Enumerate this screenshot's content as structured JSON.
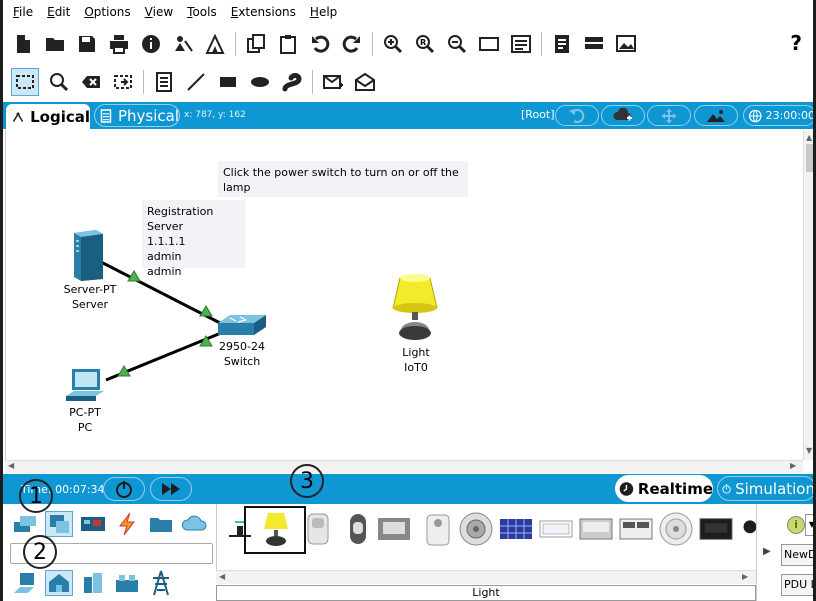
{
  "menu": [
    "File",
    "Edit",
    "Options",
    "View",
    "Tools",
    "Extensions",
    "Help"
  ],
  "menu_underline": [
    "F",
    "E",
    "O",
    "V",
    "T",
    "E",
    "H"
  ],
  "toolbar": {
    "main_icons": [
      "new-file-icon",
      "open-folder-icon",
      "save-icon",
      "print-icon",
      "info-icon",
      "network-wizard-icon",
      "activity-wizard-icon",
      "copy-icon",
      "paste-icon",
      "undo-icon",
      "redo-icon",
      "zoom-in-icon",
      "zoom-reset-icon",
      "zoom-out-icon",
      "drawing-palette-icon",
      "custom-device-icon",
      "viewport-icon",
      "network-info-icon",
      "palette-icon",
      "screenshot-icon"
    ],
    "help_label": "?",
    "edit_icons": [
      "select-icon",
      "inspect-icon",
      "delete-icon",
      "resize-icon",
      "note-icon",
      "line-icon",
      "rectangle-icon",
      "ellipse-icon",
      "freeform-icon",
      "simple-pdu-icon",
      "complex-pdu-icon"
    ]
  },
  "nav": {
    "logical_label": "Logical",
    "physical_label": "Physical",
    "coords": "x: 787, y: 162",
    "root_label": "[Root]",
    "clock": "23:00:00",
    "accent": "#0e97d3"
  },
  "canvas": {
    "notes": [
      {
        "lines": [
          "Click the power switch to turn on or off the lamp"
        ]
      },
      {
        "lines": [
          "Registration Server",
          "1.1.1.1",
          "admin",
          "admin"
        ]
      }
    ],
    "devices": [
      {
        "type": "Server-PT",
        "name": "Server"
      },
      {
        "type": "2950-24",
        "name": "Switch"
      },
      {
        "type": "PC-PT",
        "name": "PC"
      },
      {
        "type": "Light",
        "name": "IoT0"
      }
    ],
    "link_color": "#000000",
    "port_up_color": "#4caf50",
    "lamp_color": "#f2ea2a"
  },
  "bottom": {
    "time_label": "Time: 00:07:34",
    "realtime_label": "Realtime",
    "simulation_label": "Simulation",
    "callouts": [
      "1",
      "2",
      "3"
    ],
    "selected_item_name": "Light",
    "right_buttons": [
      "New",
      "Delete",
      "PDU List"
    ]
  }
}
